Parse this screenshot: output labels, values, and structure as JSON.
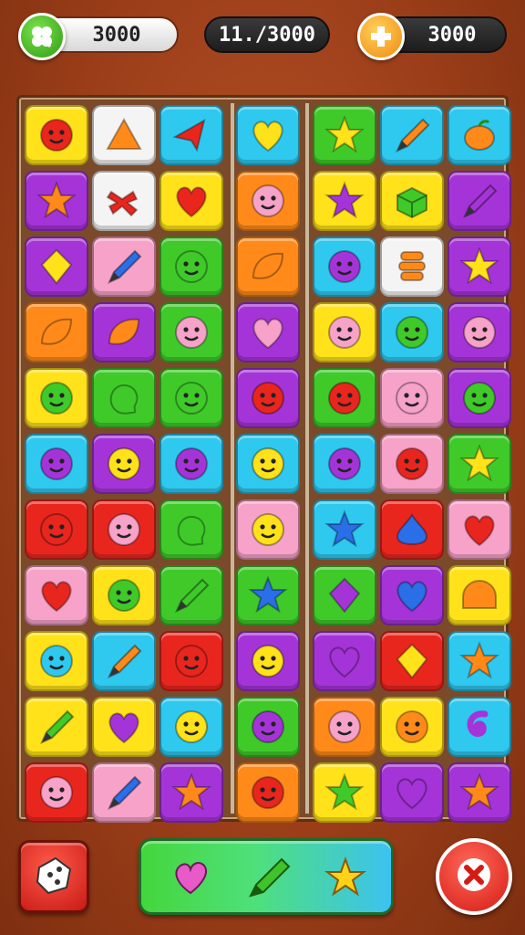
{
  "hud": {
    "left_counter": "3000",
    "moves": "11./3000",
    "right_counter": "3000",
    "left_icon": "clover-icon",
    "right_icon": "plus-icon"
  },
  "board": {
    "columns": 7,
    "rows": 11,
    "tiles": [
      [
        "yellow:face-red",
        "white:triangle-orange",
        "cyan:arrow-red",
        "cyan:heart-yellow",
        "green:star-yellow",
        "cyan:pencil-orange",
        "cyan:fruit-orange"
      ],
      [
        "purple:star-orange",
        "white:bone-red",
        "yellow:heart-red",
        "orange:face-pink",
        "yellow:star-purple",
        "yellow:box-green",
        "purple:pencil-purple"
      ],
      [
        "purple:diamond-yellow",
        "pink:pencil-blue",
        "green:face-green",
        "orange:leaf-orange",
        "cyan:face-purple",
        "white:stack-orange",
        "purple:star-yellow"
      ],
      [
        "orange:leaf-orange",
        "purple:leaf-orange",
        "green:face-pink",
        "purple:heart-pink",
        "yellow:face-pink",
        "cyan:face-green",
        "purple:face-pink"
      ],
      [
        "yellow:face-green",
        "green:blob-green",
        "green:face-green",
        "purple:face-red",
        "green:face-red",
        "pink:face-pink",
        "purple:face-green"
      ],
      [
        "cyan:face-purple",
        "purple:face-yellow",
        "cyan:face-purple",
        "cyan:face-yellow",
        "cyan:face-purple",
        "pink:face-red",
        "green:star-yellow"
      ],
      [
        "red:face-red",
        "red:face-pink",
        "green:blob-green",
        "pink:face-yellow",
        "cyan:star-blue",
        "red:drop-blue",
        "pink:heart-red"
      ],
      [
        "pink:heart-red",
        "yellow:face-green",
        "green:pencil-green",
        "green:star-blue",
        "green:diamond-purple",
        "purple:heart-blue",
        "yellow:dome-orange"
      ],
      [
        "yellow:face-cyan",
        "cyan:pencil-orange",
        "red:face-red",
        "purple:face-yellow",
        "purple:heart-purple",
        "red:diamond-yellow",
        "cyan:star-orange"
      ],
      [
        "yellow:pencil-green",
        "yellow:heart-purple",
        "cyan:face-yellow",
        "green:face-purple",
        "orange:face-pink",
        "yellow:face-orange",
        "cyan:swirl-purple"
      ],
      [
        "red:face-pink",
        "pink:pencil-blue",
        "purple:star-orange",
        "orange:face-red",
        "yellow:star-green",
        "purple:heart-purple",
        "purple:star-orange"
      ]
    ]
  },
  "bottom": {
    "left_button_icon": "cube-icon",
    "tray_items": [
      "heart-pink",
      "pencil-green",
      "star-yellow"
    ],
    "right_button_icon": "close-icon"
  },
  "colors": {
    "red": "#e8261e",
    "orange": "#ff8a1a",
    "yellow": "#ffe21a",
    "green": "#3fca2a",
    "cyan": "#2fc8ee",
    "purple": "#a534d8",
    "pink": "#f7a2c8",
    "white": "#f4f4f4",
    "blue": "#2a6ee8"
  }
}
